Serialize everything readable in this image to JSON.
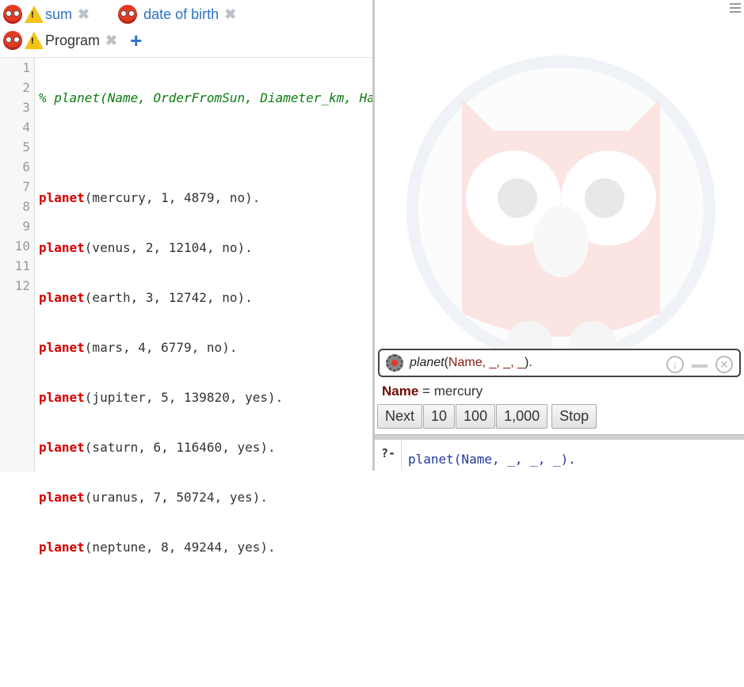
{
  "tabs_row1": [
    {
      "label": "sum",
      "has_warning": true,
      "closable": true
    },
    {
      "label": "date of birth",
      "has_warning": false,
      "closable": true
    }
  ],
  "tabs_row2": [
    {
      "label": "Program",
      "has_warning": true,
      "closable": true
    }
  ],
  "add_tab_symbol": "+",
  "close_symbol": "✖",
  "warning_symbol": "!",
  "editor": {
    "line_numbers": [
      "1",
      "2",
      "3",
      "4",
      "5",
      "6",
      "7",
      "8",
      "9",
      "10",
      "11",
      "12"
    ],
    "comment": "% planet(Name, OrderFromSun, Diameter_km, Ha",
    "facts": [
      {
        "pred": "planet",
        "args": "(mercury, 1, 4879, no)."
      },
      {
        "pred": "planet",
        "args": "(venus, 2, 12104, no)."
      },
      {
        "pred": "planet",
        "args": "(earth, 3, 12742, no)."
      },
      {
        "pred": "planet",
        "args": "(mars, 4, 6779, no)."
      },
      {
        "pred": "planet",
        "args": "(jupiter, 5, 139820, yes)."
      },
      {
        "pred": "planet",
        "args": "(saturn, 6, 116460, yes)."
      },
      {
        "pred": "planet",
        "args": "(uranus, 7, 50724, yes)."
      },
      {
        "pred": "planet",
        "args": "(neptune, 8, 49244, yes)."
      }
    ]
  },
  "query_panel": {
    "pred": "planet",
    "open": "(",
    "var": "Name",
    "rest": ", _, _, _",
    "close": ")."
  },
  "answer": {
    "var": "Name",
    "eq": " = ",
    "value": "mercury"
  },
  "buttons": [
    "Next",
    "10",
    "100",
    "1,000"
  ],
  "stop_label": "Stop",
  "prompt": "?-",
  "input_query": "planet(Name, _, _, _).",
  "colors": {
    "predicate": "#d60000",
    "comment": "#0b7d10",
    "tab_link": "#2d72c4",
    "variable": "#6d0d05"
  }
}
